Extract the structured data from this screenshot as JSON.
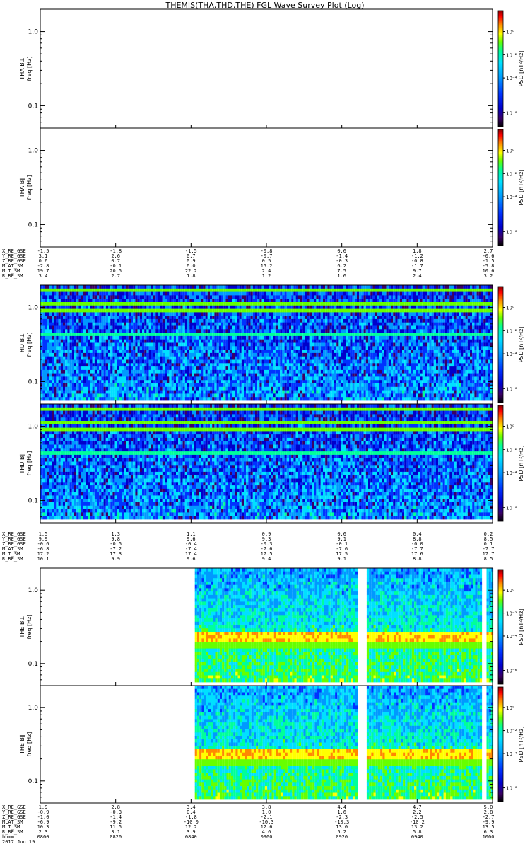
{
  "title": "THEMIS(THA,THD,THE) FGL Wave Survey Plot (Log)",
  "chart_data": {
    "type": "heatmap",
    "time_ticks": [
      "0800",
      "0820",
      "0840",
      "0900",
      "0920",
      "0940",
      "1000"
    ],
    "date": "2017 Jun 19",
    "panels": [
      {
        "probe": "tha",
        "label": "THA B⊥",
        "ylabel": "freq [Hz]",
        "yticks": [
          "1.0",
          "0.1"
        ],
        "ylim": [
          0.05,
          2.0
        ],
        "yscale": "log",
        "has_data": false,
        "cbar_label": "PSD [nT²/Hz]",
        "cbar_ticks": [
          "10⁰",
          "10⁻²",
          "10⁻⁴",
          "10⁻⁶"
        ]
      },
      {
        "probe": "tha",
        "label": "THA B∥",
        "ylabel": "freq [Hz]",
        "yticks": [
          "1.0",
          "0.1"
        ],
        "ylim": [
          0.05,
          2.0
        ],
        "yscale": "log",
        "has_data": false,
        "cbar_label": "PSD [nT²/Hz]",
        "cbar_ticks": [
          "10⁰",
          "10⁻²",
          "10⁻⁴",
          "10⁻⁶"
        ]
      },
      {
        "probe": "thd",
        "label": "THD B⊥",
        "ylabel": "freq [Hz]",
        "yticks": [
          "1.0",
          "0.1"
        ],
        "ylim": [
          0.05,
          2.0
        ],
        "yscale": "log",
        "has_data": true,
        "data_time_range": [
          "0800",
          "1000"
        ],
        "cbar_label": "PSD [nT²/Hz]",
        "cbar_ticks": [
          "10⁰",
          "10⁻²",
          "10⁻⁴",
          "10⁻⁶"
        ]
      },
      {
        "probe": "thd",
        "label": "THD B∥",
        "ylabel": "freq [Hz]",
        "yticks": [
          "1.0",
          "0.1"
        ],
        "ylim": [
          0.05,
          2.0
        ],
        "yscale": "log",
        "has_data": true,
        "data_time_range": [
          "0800",
          "1000"
        ],
        "cbar_label": "PSD [nT²/Hz]",
        "cbar_ticks": [
          "10⁰",
          "10⁻²",
          "10⁻⁴",
          "10⁻⁶"
        ]
      },
      {
        "probe": "the",
        "label": "THE B⊥",
        "ylabel": "freq [Hz]",
        "yticks": [
          "1.0",
          "0.1"
        ],
        "ylim": [
          0.05,
          2.0
        ],
        "yscale": "log",
        "has_data": true,
        "data_time_range": [
          "0841",
          "1000"
        ],
        "data_gaps": [
          [
            "0924",
            "0926"
          ],
          [
            "0957",
            "0958"
          ]
        ],
        "cbar_label": "PSD [nT²/Hz]",
        "cbar_ticks": [
          "10⁰",
          "10⁻²",
          "10⁻⁴",
          "10⁻⁶"
        ]
      },
      {
        "probe": "the",
        "label": "THE B∥",
        "ylabel": "freq [Hz]",
        "yticks": [
          "1.0",
          "0.1"
        ],
        "ylim": [
          0.05,
          2.0
        ],
        "yscale": "log",
        "has_data": true,
        "data_time_range": [
          "0841",
          "1000"
        ],
        "data_gaps": [
          [
            "0924",
            "0926"
          ],
          [
            "0957",
            "0958"
          ]
        ],
        "cbar_label": "PSD [nT²/Hz]",
        "cbar_ticks": [
          "10⁰",
          "10⁻²",
          "10⁻⁴",
          "10⁻⁶"
        ]
      }
    ],
    "ephemeris": [
      {
        "probe": "tha",
        "rows": [
          {
            "label": "X_RE_GSE",
            "values": [
              "-1.5",
              "-1.8",
              "-1.5",
              "-0.8",
              "0.6",
              "1.8",
              "2.7"
            ]
          },
          {
            "label": "Y_RE_GSE",
            "values": [
              "3.1",
              "2.6",
              "0.7",
              "-0.7",
              "-1.4",
              "-1.2",
              "-0.6"
            ]
          },
          {
            "label": "Z_RE_GSE",
            "values": [
              "0.6",
              "0.7",
              "0.9",
              "0.5",
              "-0.3",
              "-0.8",
              "-1.5"
            ]
          },
          {
            "label": "MLAT_SM",
            "values": [
              "-2.8",
              "-0.1",
              "6.0",
              "15.2",
              "6.2",
              "-1.7",
              "-5.8"
            ]
          },
          {
            "label": "MLT_SM",
            "values": [
              "19.7",
              "20.5",
              "22.2",
              "2.4",
              "7.5",
              "9.7",
              "10.6"
            ]
          },
          {
            "label": "R_RE_SM",
            "values": [
              "3.4",
              "2.7",
              "1.8",
              "1.2",
              "1.6",
              "2.4",
              "3.2"
            ]
          }
        ]
      },
      {
        "probe": "thd",
        "rows": [
          {
            "label": "X_RE_GSE",
            "values": [
              "1.5",
              "1.3",
              "1.1",
              "0.9",
              "0.6",
              "0.4",
              "0.2"
            ]
          },
          {
            "label": "Y_RE_GSE",
            "values": [
              "9.9",
              "9.8",
              "9.6",
              "9.3",
              "9.1",
              "8.8",
              "8.5"
            ]
          },
          {
            "label": "Z_RE_GSE",
            "values": [
              "-0.6",
              "-0.5",
              "-0.4",
              "-0.3",
              "-0.1",
              "-0.0",
              "0.1"
            ]
          },
          {
            "label": "MLAT_SM",
            "values": [
              "-6.8",
              "-7.2",
              "-7.4",
              "-7.6",
              "-7.6",
              "-7.7",
              "-7.7"
            ]
          },
          {
            "label": "MLT_SM",
            "values": [
              "17.2",
              "17.3",
              "17.4",
              "17.5",
              "17.5",
              "17.6",
              "17.7"
            ]
          },
          {
            "label": "R_RE_SM",
            "values": [
              "10.1",
              "9.9",
              "9.6",
              "9.4",
              "9.1",
              "8.8",
              "8.5"
            ]
          }
        ]
      },
      {
        "probe": "the",
        "rows": [
          {
            "label": "X_RE_GSE",
            "values": [
              "1.9",
              "2.8",
              "3.4",
              "3.8",
              "4.4",
              "4.7",
              "5.0"
            ]
          },
          {
            "label": "Y_RE_GSE",
            "values": [
              "-0.9",
              "-0.3",
              "0.4",
              "1.0",
              "1.6",
              "2.2",
              "2.8"
            ]
          },
          {
            "label": "Z_RE_GSE",
            "values": [
              "-1.0",
              "-1.4",
              "-1.8",
              "-2.1",
              "-2.3",
              "-2.5",
              "-2.7"
            ]
          },
          {
            "label": "MLAT_SM",
            "values": [
              "-6.9",
              "-9.2",
              "-10.0",
              "-10.3",
              "-10.3",
              "-10.2",
              "-9.9"
            ]
          },
          {
            "label": "MLT_SM",
            "values": [
              "10.3",
              "11.5",
              "12.2",
              "12.6",
              "13.0",
              "13.2",
              "13.5"
            ]
          },
          {
            "label": "R_RE_SM",
            "values": [
              "2.3",
              "3.1",
              "3.9",
              "4.6",
              "5.2",
              "5.8",
              "6.3"
            ]
          }
        ]
      }
    ],
    "time_row_label": "hhmm"
  },
  "colors": {
    "colormap": [
      "#000000",
      "#3a0066",
      "#0000cc",
      "#0033ff",
      "#0099ff",
      "#00e0ff",
      "#00ff99",
      "#66ff00",
      "#ffff00",
      "#ff8800",
      "#ff0000",
      "#880000"
    ]
  }
}
